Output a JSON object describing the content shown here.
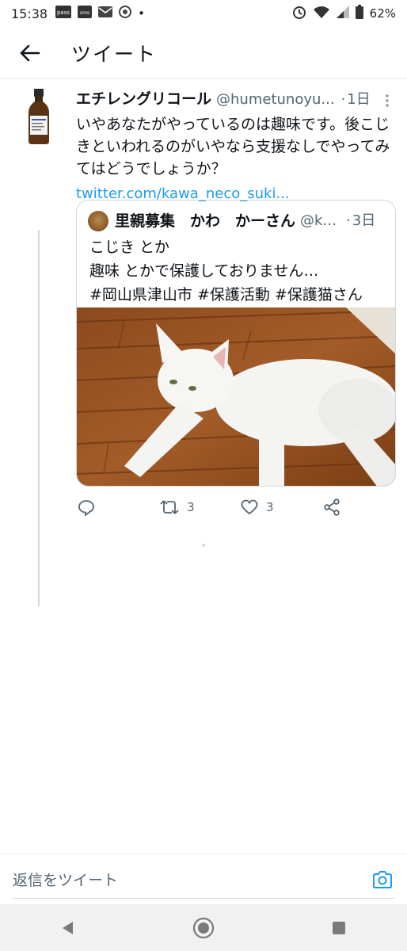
{
  "status_bar": {
    "time": "15:38",
    "notification_icons": [
      "pass-icon",
      "sms-icon",
      "mail-icon",
      "chrome-icon"
    ],
    "battery": "62%"
  },
  "header": {
    "title": "ツイート"
  },
  "tweet": {
    "display_name": "エチレングリコール",
    "handle": "@humetunoyu...",
    "separator": "·",
    "time": "1日",
    "text": "いやあなたがやっているのは趣味です。後こじきといわれるのがいやなら支援なしでやってみてはどうでしょうか？",
    "link": "twitter.com/kawa_neco_suki..."
  },
  "quote": {
    "display_name": "里親募集　かわ　かーさん",
    "handle": "@ka...",
    "separator": "·",
    "time": "3日",
    "text": "こじき とか\n趣味 とかで保護しておりません…\n#岡山県津山市 #保護活動 #保護猫さん"
  },
  "actions": {
    "reply_count": "",
    "retweet_count": "3",
    "like_count": "3"
  },
  "reply_bar": {
    "placeholder": "返信をツイート"
  },
  "colors": {
    "accent": "#1d9bf0",
    "secondary_text": "#536471",
    "border": "#cfd9de"
  }
}
